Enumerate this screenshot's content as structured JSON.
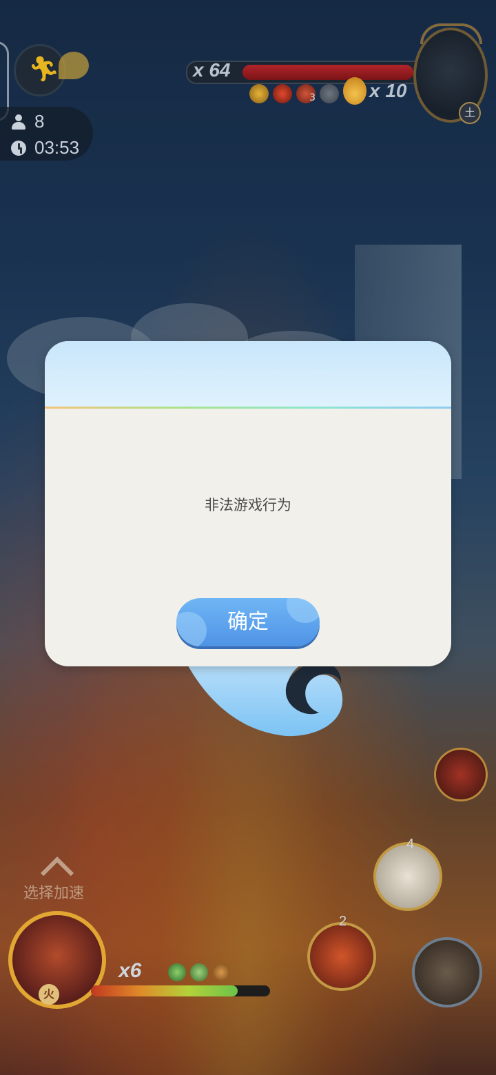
{
  "hud": {
    "player_count": "8",
    "timer": "03:53"
  },
  "boss": {
    "multiplier": "x 64",
    "hp_fraction": 0.92,
    "element_badge": "土",
    "buff_stack": "3",
    "flame_count": "x 10"
  },
  "dialog": {
    "message": "非法游戏行为",
    "confirm_label": "确定"
  },
  "hero": {
    "element_badge": "火",
    "multiplier": "x6",
    "hp_fraction": 0.82
  },
  "skills": {
    "skill_a_count": "4",
    "skill_b_count": "2"
  },
  "select_hint": "选择加速"
}
